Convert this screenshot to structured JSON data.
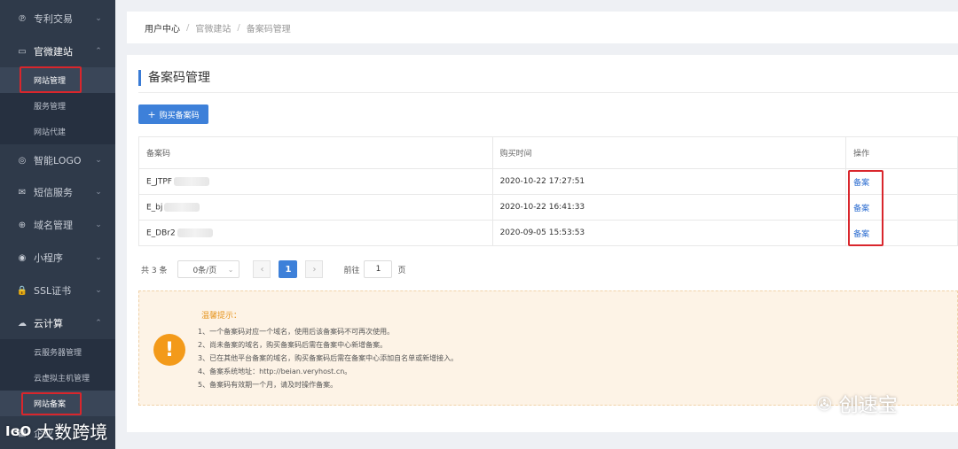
{
  "sidebar": {
    "items": [
      {
        "icon": "patent-icon",
        "glyph": "℗",
        "label": "专利交易",
        "chevron": "⌄"
      },
      {
        "icon": "monitor-icon",
        "glyph": "▭",
        "label": "官微建站",
        "chevron": "⌃"
      },
      {
        "icon": "logo-icon",
        "glyph": "◎",
        "label": "智能LOGO",
        "chevron": "⌄"
      },
      {
        "icon": "mail-icon",
        "glyph": "✉",
        "label": "短信服务",
        "chevron": "⌄"
      },
      {
        "icon": "globe-icon",
        "glyph": "⊕",
        "label": "域名管理",
        "chevron": "⌄"
      },
      {
        "icon": "miniapp-icon",
        "glyph": "◉",
        "label": "小程序",
        "chevron": "⌄"
      },
      {
        "icon": "lock-icon",
        "glyph": "🔒",
        "label": "SSL证书",
        "chevron": "⌄"
      },
      {
        "icon": "cloud-icon",
        "glyph": "☁",
        "label": "云计算",
        "chevron": "⌃"
      },
      {
        "icon": "enterprise-icon",
        "glyph": "▦",
        "label": "企业"
      }
    ],
    "site_sub": [
      "网站管理",
      "服务管理",
      "网站代建"
    ],
    "cloud_sub": [
      "云服务器管理",
      "云虚拟主机管理",
      "网站备案"
    ]
  },
  "breadcrumb": {
    "items": [
      "用户中心",
      "官微建站",
      "备案码管理"
    ],
    "separator": "/"
  },
  "page": {
    "title": "备案码管理",
    "buy_button": "购买备案码",
    "buy_button_icon": "+"
  },
  "table": {
    "headers": [
      "备案码",
      "购买时间",
      "操作"
    ],
    "rows": [
      {
        "code": "E_JTPF",
        "time": "2020-10-22 17:27:51",
        "action": "备案"
      },
      {
        "code": "E_bj",
        "time": "2020-10-22 16:41:33",
        "action": "备案"
      },
      {
        "code": "E_DBr2",
        "time": "2020-09-05 15:53:53",
        "action": "备案"
      }
    ]
  },
  "pagination": {
    "total": "共 3 条",
    "page_size": "0条/页",
    "prev": "‹",
    "current": "1",
    "next": "›",
    "goto_label": "前往",
    "goto_value": "1",
    "goto_suffix": "页"
  },
  "notice": {
    "icon_glyph": "!",
    "title": "温馨提示：",
    "items": [
      "1、一个备案码对应一个域名，使用后该备案码不可再次使用。",
      "2、尚未备案的域名，购买备案码后需在备案中心新增备案。",
      "3、已在其他平台备案的域名，购买备案码后需在备案中心添加自名单或新增接入。",
      "4、备案系统地址：http://beian.veryhost.cn。",
      "5、备案码有效期一个月，请及时操作备案。"
    ]
  },
  "watermarks": {
    "right": "创速宝",
    "right_glyph": "✇",
    "left": "大数跨境",
    "left_mark": "IɞO"
  },
  "colors": {
    "sidebar_bg": "#2f3a4a",
    "accent": "#3d80d9",
    "highlight_box": "#d9262c",
    "notice_bg": "#fdf3e6",
    "warning": "#f39a1a"
  }
}
